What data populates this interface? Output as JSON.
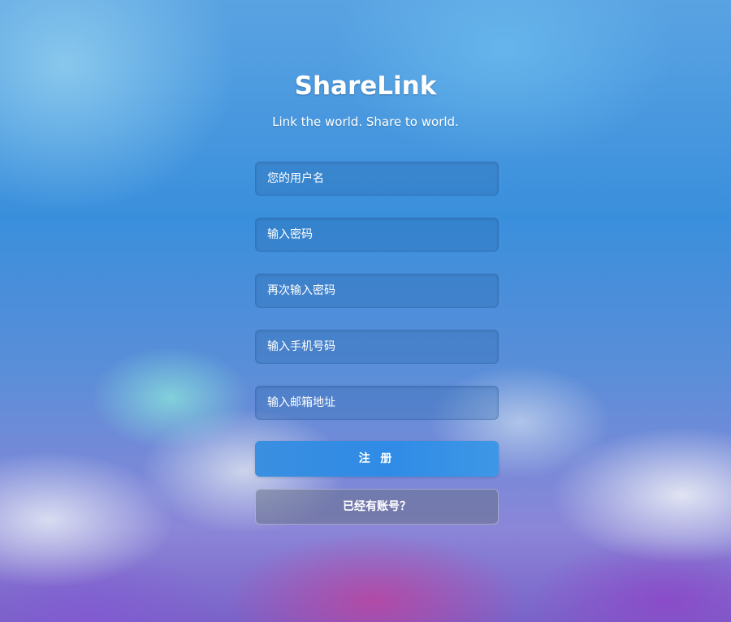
{
  "app": {
    "title": "ShareLink",
    "tagline": "Link the world. Share to world."
  },
  "form": {
    "username": {
      "placeholder": "您的用户名",
      "value": ""
    },
    "password": {
      "placeholder": "输入密码",
      "value": ""
    },
    "confirm_password": {
      "placeholder": "再次输入密码",
      "value": ""
    },
    "phone": {
      "placeholder": "输入手机号码",
      "value": ""
    },
    "email": {
      "placeholder": "输入邮箱地址",
      "value": ""
    }
  },
  "buttons": {
    "register_label": "注 册",
    "have_account_label": "已经有账号？"
  },
  "colors": {
    "primary_button": "#2f8be6",
    "secondary_button": "#6e7a8c",
    "text": "#ffffff"
  }
}
